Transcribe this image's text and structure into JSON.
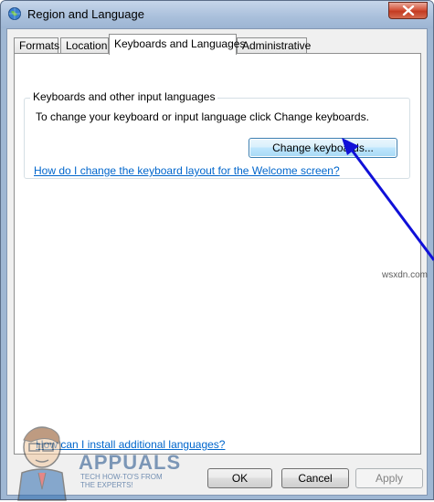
{
  "window": {
    "title": "Region and Language",
    "close_icon": "close-icon",
    "app_icon": "globe-icon"
  },
  "tabs": [
    {
      "label": "Formats",
      "active": false
    },
    {
      "label": "Location",
      "active": false
    },
    {
      "label": "Keyboards and Languages",
      "active": true
    },
    {
      "label": "Administrative",
      "active": false
    }
  ],
  "keyboards_group": {
    "title": "Keyboards and other input languages",
    "description": "To change your keyboard or input language click Change keyboards.",
    "change_button": "Change keyboards...",
    "help_link": "How do I change the keyboard layout for the Welcome screen?"
  },
  "install_link": "How can I install additional languages?",
  "footer": {
    "ok": "OK",
    "cancel": "Cancel",
    "apply": "Apply"
  },
  "watermark": {
    "brand": "APPUALS",
    "tagline_line1": "TECH HOW-TO'S FROM",
    "tagline_line2": "THE EXPERTS!",
    "site": "wsxdn.com"
  },
  "colors": {
    "link": "#0066cc",
    "arrow": "#1010d8",
    "titlebar": "#a9bfdb"
  }
}
